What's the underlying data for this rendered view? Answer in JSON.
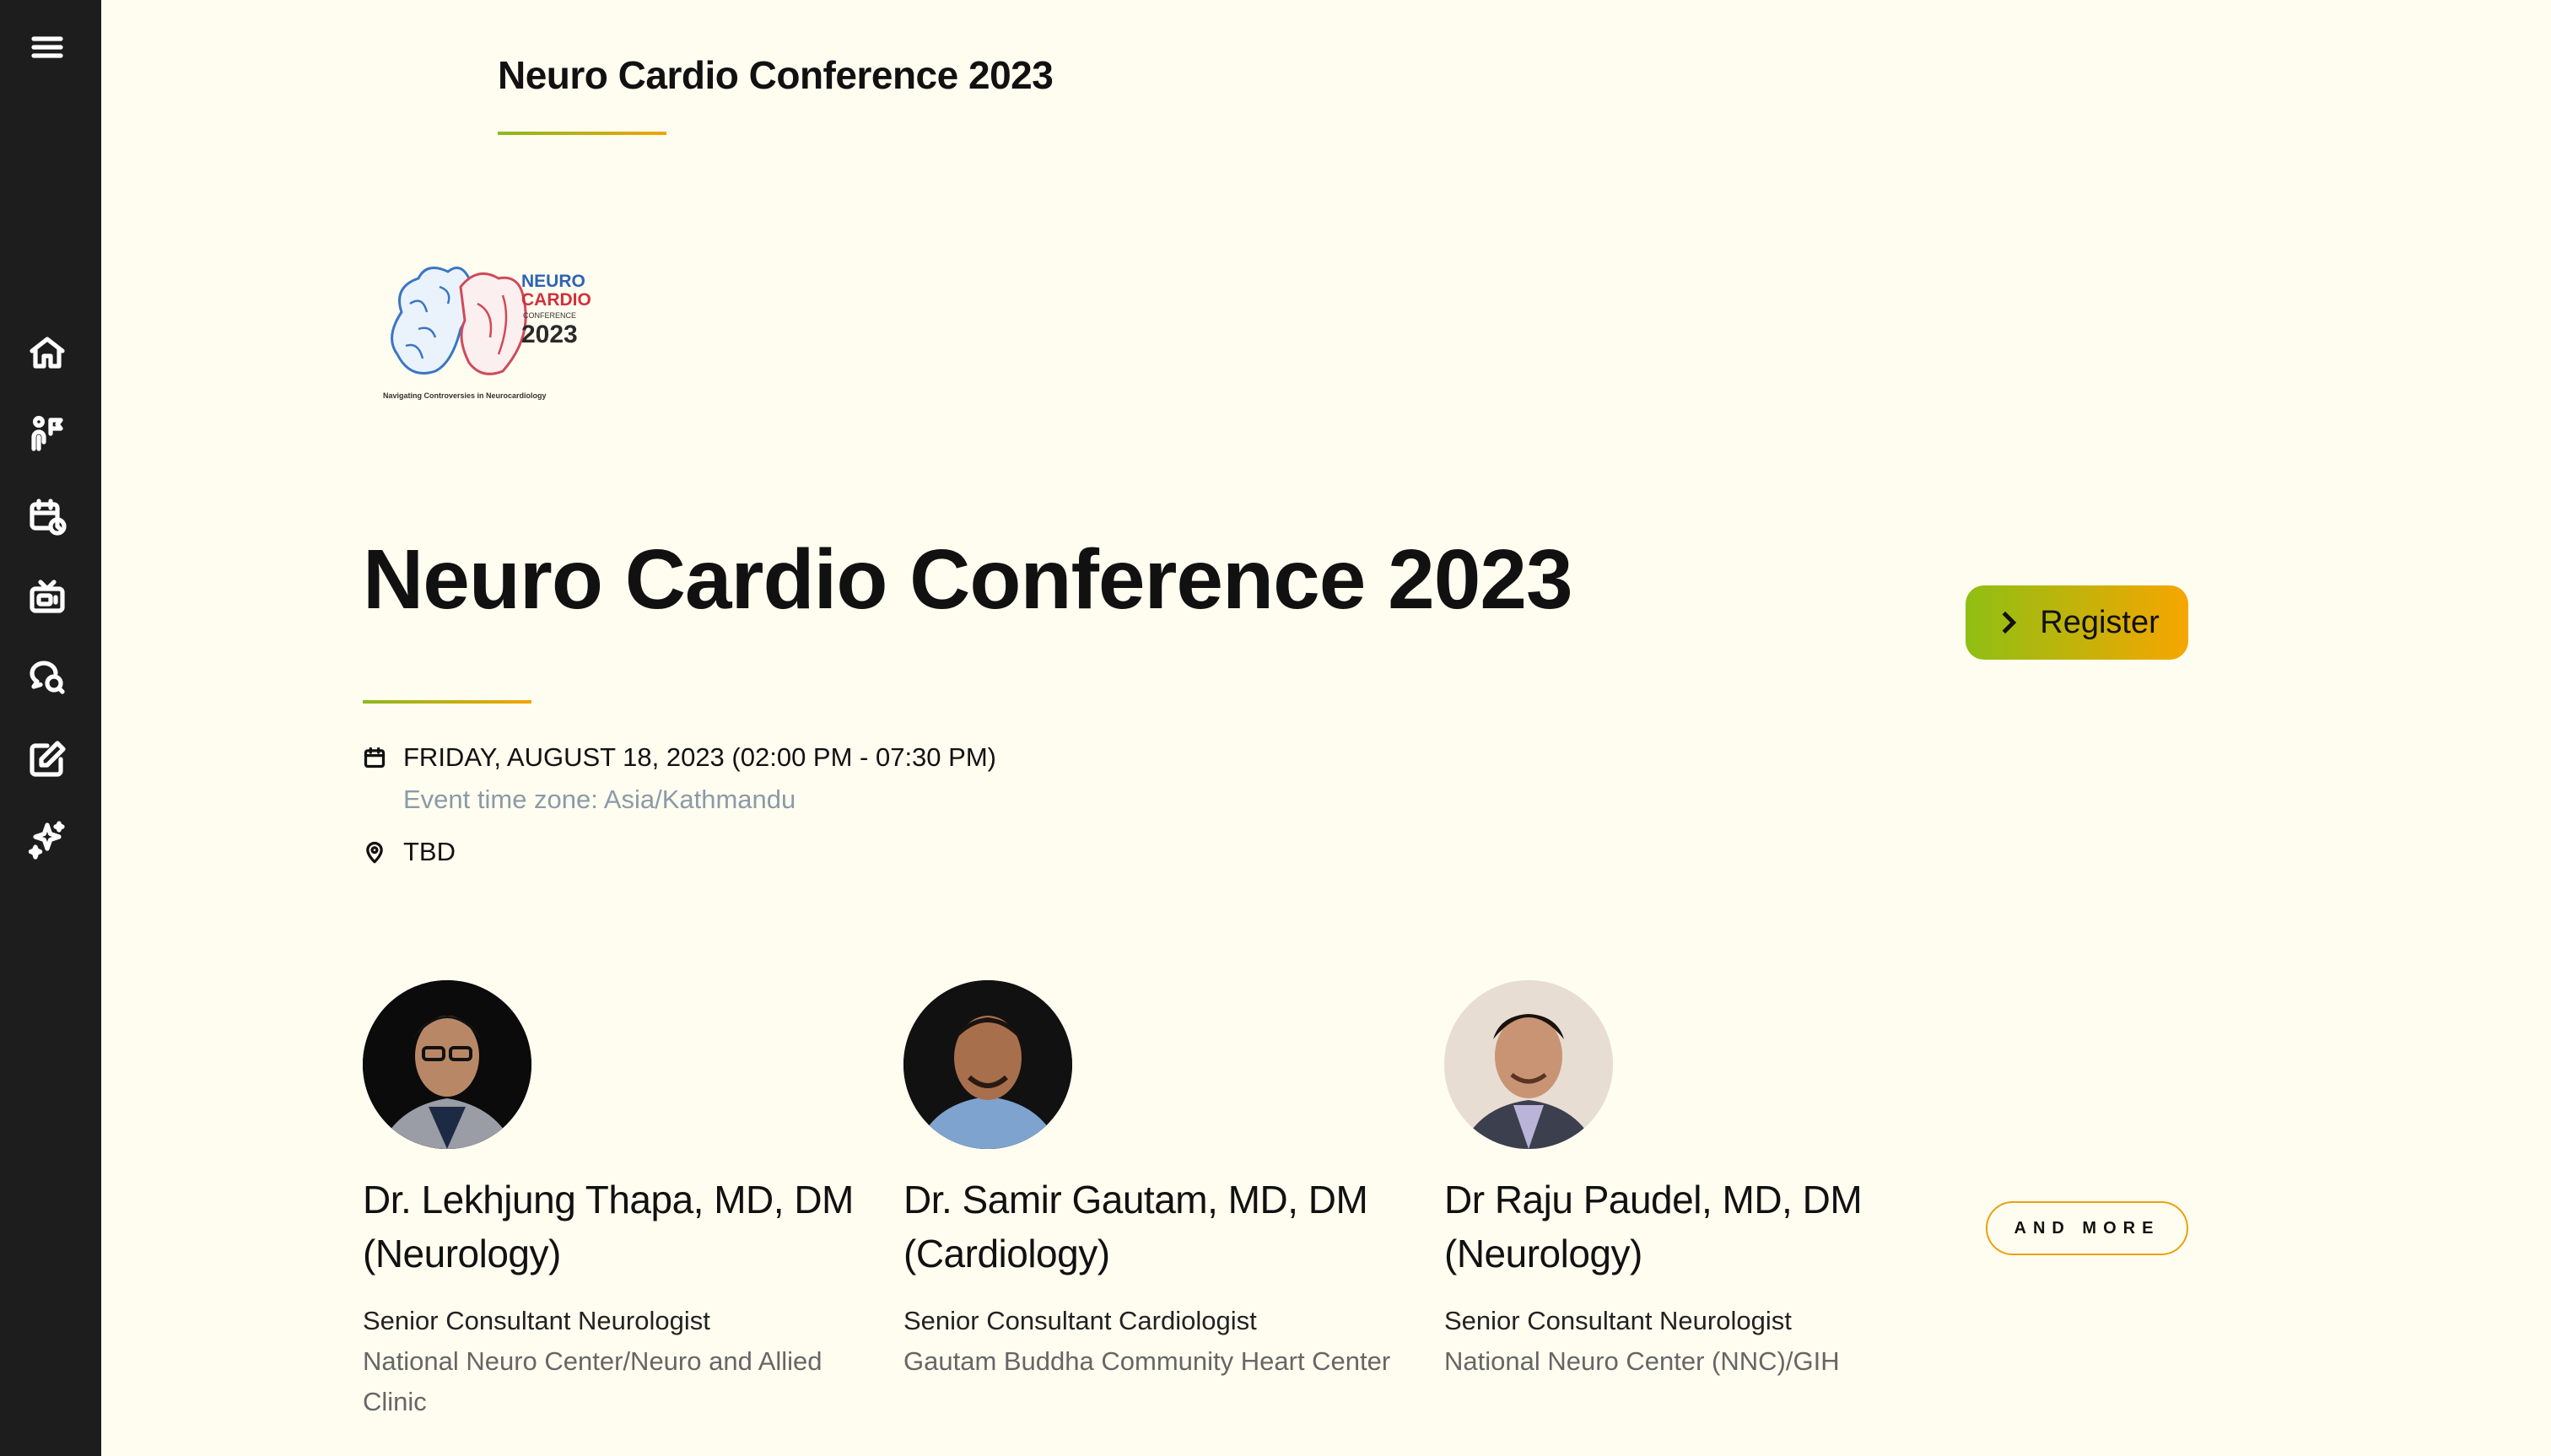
{
  "header": {
    "title": "Neuro Cardio Conference 2023"
  },
  "sidebar": {
    "items": [
      {
        "icon": "menu-icon"
      },
      {
        "icon": "home-icon"
      },
      {
        "icon": "speakers-icon"
      },
      {
        "icon": "schedule-icon"
      },
      {
        "icon": "tv-icon"
      },
      {
        "icon": "discussion-icon"
      },
      {
        "icon": "edit-icon"
      },
      {
        "icon": "sparkles-icon"
      }
    ]
  },
  "logo": {
    "line1": "NEURO",
    "line2": "CARDIO",
    "line3": "CONFERENCE",
    "year": "2023",
    "tagline": "Navigating Controversies in Neurocardiology"
  },
  "event": {
    "title": "Neuro Cardio Conference 2023",
    "date": "FRIDAY, AUGUST 18, 2023 (02:00 PM - 07:30 PM)",
    "timezone": "Event time zone: Asia/Kathmandu",
    "location": "TBD",
    "register_label": "Register"
  },
  "speakers": [
    {
      "name_line1": "Dr. Lekhjung Thapa, MD, DM",
      "name_line2": "(Neurology)",
      "role": "Senior Consultant Neurologist",
      "org": "National Neuro Center/Neuro and Allied Clinic"
    },
    {
      "name_line1": "Dr. Samir Gautam, MD, DM",
      "name_line2": "(Cardiology)",
      "role": "Senior Consultant Cardiologist",
      "org": "Gautam Buddha Community Heart Center"
    },
    {
      "name_line1": "Dr Raju Paudel, MD, DM",
      "name_line2": "(Neurology)",
      "role": "Senior Consultant Neurologist",
      "org": "National Neuro Center (NNC)/GIH"
    }
  ],
  "more_label": "AND MORE",
  "colors": {
    "accent_start": "#8fbf14",
    "accent_end": "#f6a600",
    "sidebar": "#1d1d1d",
    "background": "#fffdf0"
  }
}
